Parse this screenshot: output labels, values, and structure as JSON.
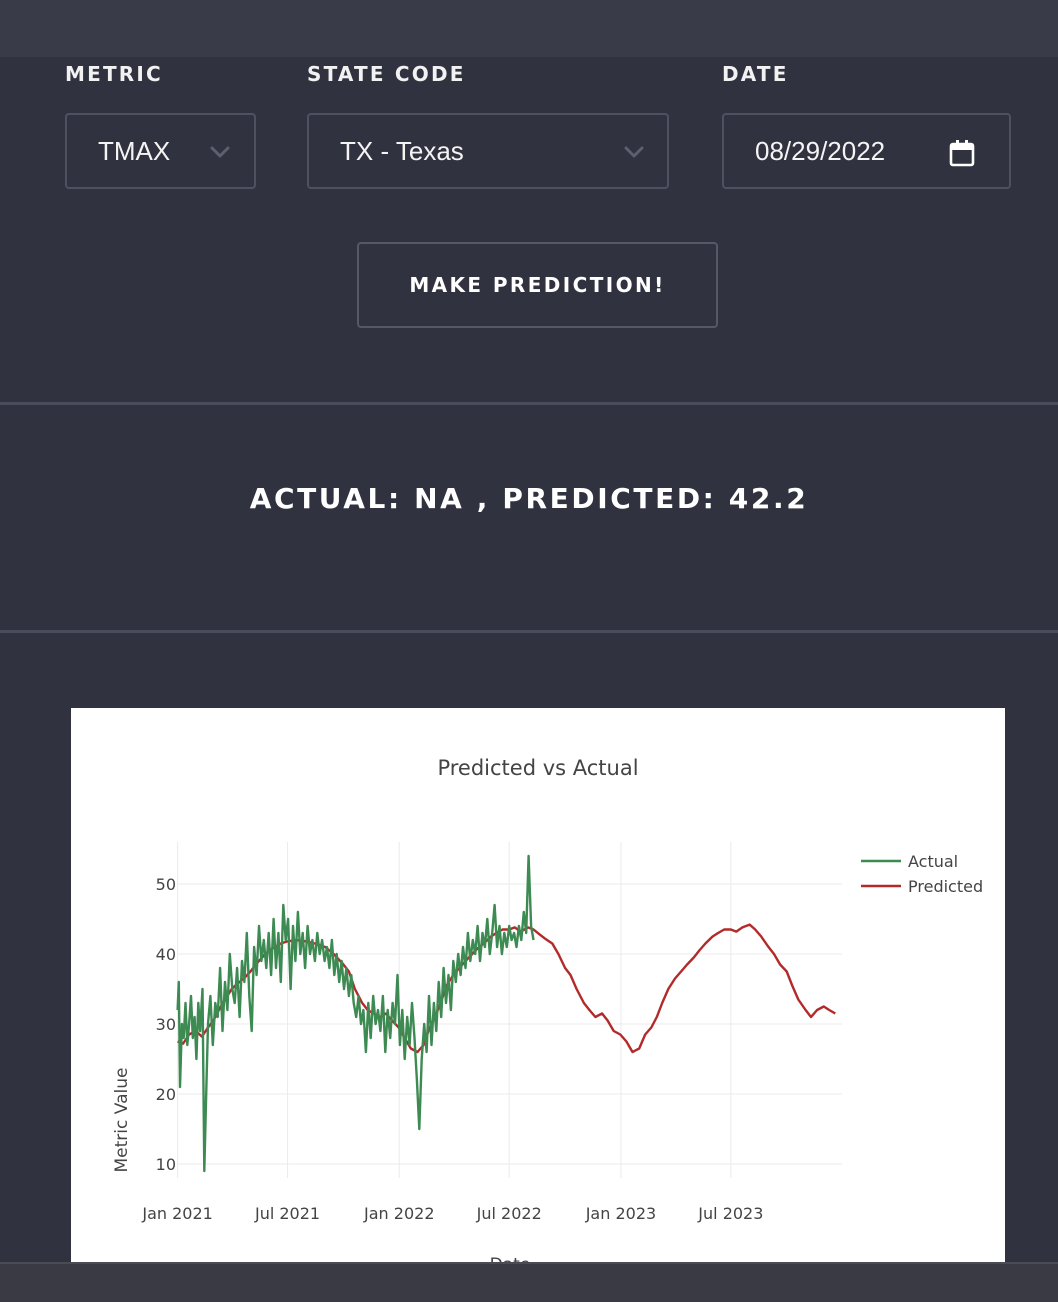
{
  "form": {
    "metric": {
      "label": "METRIC",
      "value": "TMAX"
    },
    "state": {
      "label": "STATE CODE",
      "value": "TX - Texas"
    },
    "date": {
      "label": "DATE",
      "value": "08/29/2022"
    },
    "submit_label": "MAKE PREDICTION!"
  },
  "result_text": "ACTUAL: NA , PREDICTED: 42.2",
  "colors": {
    "background": "#30323f",
    "actual": "#3d8a52",
    "predicted": "#b22a2a"
  },
  "chart_data": {
    "type": "line",
    "title": "Predicted vs Actual",
    "xlabel": "Date",
    "ylabel": "Metric Value",
    "xlim": [
      "2020-12-31",
      "2023-12-31"
    ],
    "ylim": [
      8,
      56
    ],
    "yticks": [
      10,
      20,
      30,
      40,
      50
    ],
    "xticks": [
      {
        "date": "2021-01-01",
        "label": "Jan 2021"
      },
      {
        "date": "2021-07-01",
        "label": "Jul 2021"
      },
      {
        "date": "2022-01-01",
        "label": "Jan 2022"
      },
      {
        "date": "2022-07-01",
        "label": "Jul 2022"
      },
      {
        "date": "2023-01-01",
        "label": "Jan 2023"
      },
      {
        "date": "2023-07-01",
        "label": "Jul 2023"
      }
    ],
    "grid": true,
    "legend_position": "top-right",
    "series": [
      {
        "name": "Actual",
        "color": "#3d8a52",
        "points": [
          [
            "2021-01-01",
            32
          ],
          [
            "2021-01-03",
            36
          ],
          [
            "2021-01-05",
            21
          ],
          [
            "2021-01-08",
            30
          ],
          [
            "2021-01-11",
            28
          ],
          [
            "2021-01-14",
            33
          ],
          [
            "2021-01-17",
            27
          ],
          [
            "2021-01-20",
            30
          ],
          [
            "2021-01-23",
            34
          ],
          [
            "2021-01-26",
            28
          ],
          [
            "2021-01-29",
            31
          ],
          [
            "2021-02-01",
            25
          ],
          [
            "2021-02-04",
            33
          ],
          [
            "2021-02-07",
            29
          ],
          [
            "2021-02-11",
            35
          ],
          [
            "2021-02-14",
            9
          ],
          [
            "2021-02-17",
            20
          ],
          [
            "2021-02-20",
            30
          ],
          [
            "2021-02-24",
            34
          ],
          [
            "2021-02-28",
            27
          ],
          [
            "2021-03-04",
            33
          ],
          [
            "2021-03-08",
            31
          ],
          [
            "2021-03-12",
            38
          ],
          [
            "2021-03-16",
            29
          ],
          [
            "2021-03-20",
            36
          ],
          [
            "2021-03-24",
            32
          ],
          [
            "2021-03-28",
            40
          ],
          [
            "2021-04-01",
            35
          ],
          [
            "2021-04-05",
            33
          ],
          [
            "2021-04-09",
            38
          ],
          [
            "2021-04-13",
            31
          ],
          [
            "2021-04-17",
            39
          ],
          [
            "2021-04-21",
            36
          ],
          [
            "2021-04-25",
            43
          ],
          [
            "2021-04-29",
            34
          ],
          [
            "2021-05-03",
            29
          ],
          [
            "2021-05-07",
            41
          ],
          [
            "2021-05-11",
            37
          ],
          [
            "2021-05-15",
            44
          ],
          [
            "2021-05-19",
            39
          ],
          [
            "2021-05-23",
            42
          ],
          [
            "2021-05-27",
            38
          ],
          [
            "2021-05-31",
            43
          ],
          [
            "2021-06-04",
            37
          ],
          [
            "2021-06-08",
            45
          ],
          [
            "2021-06-12",
            38
          ],
          [
            "2021-06-16",
            43
          ],
          [
            "2021-06-20",
            36
          ],
          [
            "2021-06-24",
            47
          ],
          [
            "2021-06-28",
            42
          ],
          [
            "2021-07-02",
            45
          ],
          [
            "2021-07-06",
            35
          ],
          [
            "2021-07-10",
            44
          ],
          [
            "2021-07-14",
            39
          ],
          [
            "2021-07-18",
            46
          ],
          [
            "2021-07-22",
            40
          ],
          [
            "2021-07-26",
            43
          ],
          [
            "2021-07-30",
            38
          ],
          [
            "2021-08-03",
            44
          ],
          [
            "2021-08-07",
            40
          ],
          [
            "2021-08-11",
            42
          ],
          [
            "2021-08-15",
            39
          ],
          [
            "2021-08-19",
            43
          ],
          [
            "2021-08-23",
            40
          ],
          [
            "2021-08-27",
            42
          ],
          [
            "2021-08-31",
            39
          ],
          [
            "2021-09-04",
            41
          ],
          [
            "2021-09-08",
            38
          ],
          [
            "2021-09-12",
            42
          ],
          [
            "2021-09-16",
            37
          ],
          [
            "2021-09-20",
            40
          ],
          [
            "2021-09-24",
            36
          ],
          [
            "2021-09-28",
            39
          ],
          [
            "2021-10-02",
            35
          ],
          [
            "2021-10-06",
            38
          ],
          [
            "2021-10-10",
            34
          ],
          [
            "2021-10-14",
            37
          ],
          [
            "2021-10-18",
            33
          ],
          [
            "2021-10-22",
            31
          ],
          [
            "2021-10-26",
            34
          ],
          [
            "2021-10-30",
            30
          ],
          [
            "2021-11-03",
            32
          ],
          [
            "2021-11-07",
            26
          ],
          [
            "2021-11-11",
            33
          ],
          [
            "2021-11-15",
            28
          ],
          [
            "2021-11-19",
            34
          ],
          [
            "2021-11-23",
            30
          ],
          [
            "2021-11-27",
            32
          ],
          [
            "2021-12-01",
            29
          ],
          [
            "2021-12-05",
            34
          ],
          [
            "2021-12-09",
            26
          ],
          [
            "2021-12-13",
            32
          ],
          [
            "2021-12-17",
            28
          ],
          [
            "2021-12-21",
            33
          ],
          [
            "2021-12-25",
            30
          ],
          [
            "2021-12-29",
            37
          ],
          [
            "2022-01-02",
            27
          ],
          [
            "2022-01-06",
            32
          ],
          [
            "2022-01-10",
            25
          ],
          [
            "2022-01-14",
            31
          ],
          [
            "2022-01-18",
            27
          ],
          [
            "2022-01-22",
            33
          ],
          [
            "2022-01-26",
            28
          ],
          [
            "2022-01-30",
            22
          ],
          [
            "2022-02-03",
            15
          ],
          [
            "2022-02-07",
            25
          ],
          [
            "2022-02-11",
            30
          ],
          [
            "2022-02-15",
            26
          ],
          [
            "2022-02-19",
            34
          ],
          [
            "2022-02-23",
            27
          ],
          [
            "2022-02-27",
            33
          ],
          [
            "2022-03-03",
            29
          ],
          [
            "2022-03-07",
            36
          ],
          [
            "2022-03-11",
            31
          ],
          [
            "2022-03-15",
            38
          ],
          [
            "2022-03-19",
            33
          ],
          [
            "2022-03-23",
            37
          ],
          [
            "2022-03-27",
            32
          ],
          [
            "2022-03-31",
            39
          ],
          [
            "2022-04-04",
            36
          ],
          [
            "2022-04-08",
            40
          ],
          [
            "2022-04-12",
            37
          ],
          [
            "2022-04-16",
            41
          ],
          [
            "2022-04-20",
            38
          ],
          [
            "2022-04-24",
            43
          ],
          [
            "2022-04-28",
            39
          ],
          [
            "2022-05-02",
            42
          ],
          [
            "2022-05-06",
            40
          ],
          [
            "2022-05-10",
            44
          ],
          [
            "2022-05-14",
            39
          ],
          [
            "2022-05-18",
            43
          ],
          [
            "2022-05-22",
            41
          ],
          [
            "2022-05-26",
            45
          ],
          [
            "2022-05-30",
            40
          ],
          [
            "2022-06-03",
            43
          ],
          [
            "2022-06-07",
            47
          ],
          [
            "2022-06-11",
            41
          ],
          [
            "2022-06-15",
            44
          ],
          [
            "2022-06-19",
            40
          ],
          [
            "2022-06-23",
            43
          ],
          [
            "2022-06-27",
            41
          ],
          [
            "2022-07-01",
            44
          ],
          [
            "2022-07-05",
            42
          ],
          [
            "2022-07-09",
            43
          ],
          [
            "2022-07-13",
            41
          ],
          [
            "2022-07-17",
            44
          ],
          [
            "2022-07-21",
            42
          ],
          [
            "2022-07-25",
            46
          ],
          [
            "2022-07-29",
            43
          ],
          [
            "2022-08-02",
            54
          ],
          [
            "2022-08-06",
            44
          ],
          [
            "2022-08-10",
            42
          ]
        ]
      },
      {
        "name": "Predicted",
        "color": "#b22a2a",
        "points": [
          [
            "2021-01-01",
            27.5
          ],
          [
            "2021-01-10",
            27.2
          ],
          [
            "2021-01-20",
            28.5
          ],
          [
            "2021-01-31",
            29.0
          ],
          [
            "2021-02-10",
            28.2
          ],
          [
            "2021-02-20",
            29.5
          ],
          [
            "2021-03-01",
            30.5
          ],
          [
            "2021-03-10",
            32.0
          ],
          [
            "2021-03-20",
            33.5
          ],
          [
            "2021-03-31",
            35.0
          ],
          [
            "2021-04-10",
            35.8
          ],
          [
            "2021-04-20",
            36.5
          ],
          [
            "2021-05-01",
            37.5
          ],
          [
            "2021-05-10",
            38.5
          ],
          [
            "2021-05-20",
            39.5
          ],
          [
            "2021-06-01",
            40.5
          ],
          [
            "2021-06-10",
            41.0
          ],
          [
            "2021-06-20",
            41.5
          ],
          [
            "2021-07-01",
            41.8
          ],
          [
            "2021-07-15",
            42.0
          ],
          [
            "2021-08-01",
            41.8
          ],
          [
            "2021-08-15",
            41.5
          ],
          [
            "2021-09-01",
            41.0
          ],
          [
            "2021-09-15",
            40.0
          ],
          [
            "2021-10-01",
            38.5
          ],
          [
            "2021-10-10",
            37.5
          ],
          [
            "2021-10-20",
            35.0
          ],
          [
            "2021-11-01",
            33.0
          ],
          [
            "2021-11-10",
            32.0
          ],
          [
            "2021-11-20",
            31.5
          ],
          [
            "2021-12-01",
            31.0
          ],
          [
            "2021-12-10",
            31.5
          ],
          [
            "2021-12-20",
            30.5
          ],
          [
            "2021-12-31",
            29.5
          ],
          [
            "2022-01-10",
            28.0
          ],
          [
            "2022-01-20",
            26.5
          ],
          [
            "2022-01-31",
            26.0
          ],
          [
            "2022-02-10",
            27.0
          ],
          [
            "2022-02-20",
            29.5
          ],
          [
            "2022-03-01",
            31.0
          ],
          [
            "2022-03-10",
            33.0
          ],
          [
            "2022-03-20",
            35.5
          ],
          [
            "2022-03-31",
            37.0
          ],
          [
            "2022-04-10",
            38.0
          ],
          [
            "2022-04-20",
            39.0
          ],
          [
            "2022-05-01",
            40.0
          ],
          [
            "2022-05-10",
            40.8
          ],
          [
            "2022-05-20",
            41.5
          ],
          [
            "2022-06-01",
            42.5
          ],
          [
            "2022-06-10",
            43.0
          ],
          [
            "2022-06-20",
            43.5
          ],
          [
            "2022-07-01",
            43.5
          ],
          [
            "2022-07-10",
            43.8
          ],
          [
            "2022-07-20",
            43.2
          ],
          [
            "2022-08-01",
            43.8
          ],
          [
            "2022-08-10",
            43.5
          ],
          [
            "2022-08-20",
            42.8
          ],
          [
            "2022-08-29",
            42.2
          ],
          [
            "2022-09-10",
            41.5
          ],
          [
            "2022-09-20",
            40.0
          ],
          [
            "2022-10-01",
            38.0
          ],
          [
            "2022-10-10",
            37.0
          ],
          [
            "2022-10-20",
            35.0
          ],
          [
            "2022-11-01",
            33.0
          ],
          [
            "2022-11-10",
            32.0
          ],
          [
            "2022-11-20",
            31.0
          ],
          [
            "2022-12-01",
            31.5
          ],
          [
            "2022-12-10",
            30.5
          ],
          [
            "2022-12-20",
            29.0
          ],
          [
            "2022-12-31",
            28.5
          ],
          [
            "2023-01-10",
            27.5
          ],
          [
            "2023-01-20",
            26.0
          ],
          [
            "2023-01-31",
            26.5
          ],
          [
            "2023-02-10",
            28.5
          ],
          [
            "2023-02-20",
            29.5
          ],
          [
            "2023-03-01",
            31.0
          ],
          [
            "2023-03-10",
            33.0
          ],
          [
            "2023-03-20",
            35.0
          ],
          [
            "2023-03-31",
            36.5
          ],
          [
            "2023-04-10",
            37.5
          ],
          [
            "2023-04-20",
            38.5
          ],
          [
            "2023-05-01",
            39.5
          ],
          [
            "2023-05-10",
            40.5
          ],
          [
            "2023-05-20",
            41.5
          ],
          [
            "2023-06-01",
            42.5
          ],
          [
            "2023-06-10",
            43.0
          ],
          [
            "2023-06-20",
            43.5
          ],
          [
            "2023-07-01",
            43.5
          ],
          [
            "2023-07-10",
            43.2
          ],
          [
            "2023-07-20",
            43.8
          ],
          [
            "2023-08-01",
            44.2
          ],
          [
            "2023-08-10",
            43.5
          ],
          [
            "2023-08-20",
            42.5
          ],
          [
            "2023-09-01",
            41.0
          ],
          [
            "2023-09-10",
            40.0
          ],
          [
            "2023-09-20",
            38.5
          ],
          [
            "2023-10-01",
            37.5
          ],
          [
            "2023-10-10",
            35.5
          ],
          [
            "2023-10-20",
            33.5
          ],
          [
            "2023-11-01",
            32.0
          ],
          [
            "2023-11-10",
            31.0
          ],
          [
            "2023-11-20",
            32.0
          ],
          [
            "2023-12-01",
            32.5
          ],
          [
            "2023-12-10",
            32.0
          ],
          [
            "2023-12-20",
            31.5
          ]
        ]
      }
    ]
  }
}
